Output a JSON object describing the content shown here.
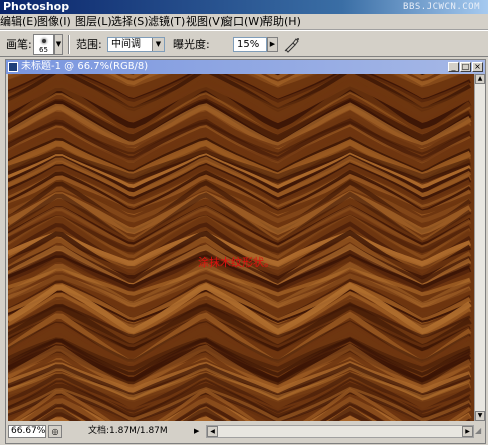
{
  "app": {
    "title": "Photoshop",
    "watermark": "BBS.JCWCN.COM"
  },
  "menu": {
    "items": [
      "编辑(E)",
      "图像(I)",
      "图层(L)",
      "选择(S)",
      "滤镜(T)",
      "视图(V)",
      "窗口(W)",
      "帮助(H)"
    ]
  },
  "options": {
    "brush_label": "画笔:",
    "brush_size": "65",
    "range_label": "范围:",
    "range_value": "中间调",
    "exposure_label": "曝光度:",
    "exposure_value": "15%",
    "airbrush_icon": "airbrush-icon"
  },
  "document": {
    "title": "未标题-1 @ 66.7%(RGB/8)",
    "canvas_note": "涂抹木纹形状。",
    "wood_colors": {
      "dark": "#3a1405",
      "mid": "#6e3610",
      "light": "#9a5a22",
      "highlight": "#b06e2e"
    }
  },
  "status": {
    "zoom": "66.67%",
    "doc_info": "文档:1.87M/1.87M"
  },
  "colors": {
    "title_bar": "#0a246a",
    "doc_title_bar": "#7a96df",
    "chrome": "#d4d0c8",
    "note_text": "#e01010"
  }
}
